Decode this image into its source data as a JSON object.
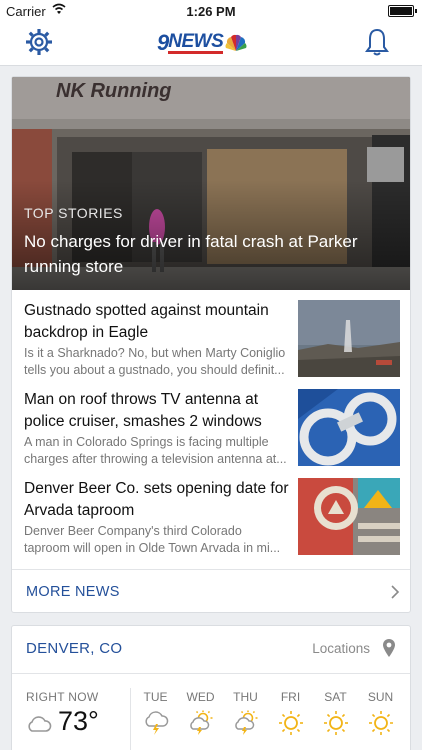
{
  "status_bar": {
    "carrier": "Carrier",
    "time": "1:26 PM"
  },
  "nav": {
    "logo_number": "9",
    "logo_word": "NEWS"
  },
  "hero": {
    "section": "TOP STORIES",
    "headline": "No charges for driver in fatal crash at Parker running store",
    "photo_sign": "NK Running"
  },
  "stories": [
    {
      "title": "Gustnado spotted against mountain backdrop in Eagle",
      "desc_line1": "Is it a Sharknado? No, but when Marty Coniglio",
      "desc_line2": "tells you about a gustnado, you should definit..."
    },
    {
      "title": "Man on roof throws TV antenna at police cruiser, smashes 2 windows",
      "desc_line1": "A man in Colorado Springs is facing multiple",
      "desc_line2": "charges after throwing a television antenna at..."
    },
    {
      "title": "Denver Beer Co. sets opening date for Arvada taproom",
      "desc_line1": "Denver Beer Company's third Colorado",
      "desc_line2": "taproom will open in Olde Town Arvada in mi..."
    }
  ],
  "more_news": "MORE NEWS",
  "weather": {
    "city": "DENVER, CO",
    "locations_label": "Locations",
    "now_label": "RIGHT NOW",
    "now_temp": "73°",
    "now_icon": "cloud-icon",
    "forecast": [
      {
        "day": "TUE",
        "icon": "storm-icon"
      },
      {
        "day": "WED",
        "icon": "sun-storm-icon"
      },
      {
        "day": "THU",
        "icon": "sun-storm-icon"
      },
      {
        "day": "FRI",
        "icon": "sun-icon"
      },
      {
        "day": "SAT",
        "icon": "sun-icon"
      },
      {
        "day": "SUN",
        "icon": "sun-icon"
      }
    ]
  },
  "colors": {
    "accent": "#24509a",
    "sun": "#f2b417",
    "logo_red": "#d32a2a"
  }
}
